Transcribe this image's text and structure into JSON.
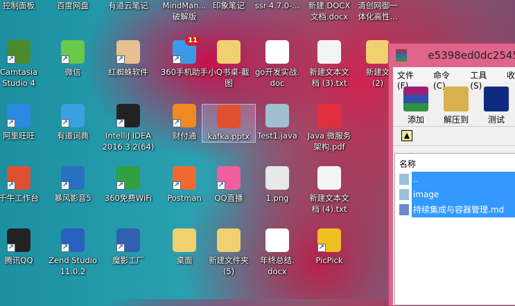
{
  "desktop": {
    "rows": [
      [
        {
          "label": "控制面板"
        },
        {
          "label": "百度网盘"
        },
        {
          "label": "有道云笔记"
        },
        {
          "label": "MindMan...\n破解版"
        },
        {
          "label": "印象笔记"
        },
        {
          "label": "ssr-4.7.0-..."
        },
        {
          "label": "新建 DOCX\n文档.docx"
        },
        {
          "label": "清创网御一\n体化高性..."
        }
      ],
      [
        {
          "label": "Camtasia\nStudio 4",
          "icon": "camtasia-icon",
          "color": "#4a8a2a",
          "shortcut": true
        },
        {
          "label": "微信",
          "icon": "wechat-icon",
          "color": "#6ac94a",
          "shortcut": true
        },
        {
          "label": "红蜘蛛软件",
          "icon": "red-spider-icon",
          "color": "#e8c090",
          "shortcut": true
        },
        {
          "label": "360手机助手",
          "icon": "360-phone-icon",
          "color": "#3a9ae8",
          "shortcut": true,
          "badge": "11"
        },
        {
          "label": "小Q书桌-截\n图",
          "icon": "folder-icon",
          "color": "#f0d070"
        },
        {
          "label": "go开发实战.\ndoc",
          "icon": "word-doc-icon",
          "color": "#ffffff"
        },
        {
          "label": "新建文本文\n档 (3).txt",
          "icon": "text-file-icon",
          "color": "#f4f4f4"
        },
        {
          "label": "新建文\n(2)",
          "icon": "folder-icon",
          "color": "#f0d070"
        }
      ],
      [
        {
          "label": "阿里旺旺",
          "icon": "aliwangwang-icon",
          "color": "#2a8ae0",
          "shortcut": true
        },
        {
          "label": "有道词典",
          "icon": "youdao-dict-icon",
          "color": "#3aa0e0",
          "shortcut": true
        },
        {
          "label": "IntelliJ IDEA\n2016.3.2(64)",
          "icon": "intellij-icon",
          "color": "#222222",
          "shortcut": true
        },
        {
          "label": "财付通",
          "icon": "tenpay-icon",
          "color": "#f08a20",
          "shortcut": true
        },
        {
          "label": "kafka.pptx",
          "icon": "pptx-icon",
          "color": "#e05030",
          "selected": true
        },
        {
          "label": "Test1.java",
          "icon": "java-file-icon",
          "color": "#a0c0d0"
        },
        {
          "label": "Java 微服务\n架构.pdf",
          "icon": "pdf-icon",
          "color": "#e03040"
        }
      ],
      [
        {
          "label": "千牛工作台",
          "icon": "qianniu-icon",
          "color": "#e05030",
          "shortcut": true
        },
        {
          "label": "暴风影音5",
          "icon": "baofeng-icon",
          "color": "#2a70c0",
          "shortcut": true
        },
        {
          "label": "360免费WiFi",
          "icon": "wifi-icon",
          "color": "#30a040",
          "shortcut": true
        },
        {
          "label": "Postman",
          "icon": "postman-icon",
          "color": "#f06a30",
          "shortcut": true
        },
        {
          "label": "QQ直播",
          "icon": "qq-live-icon",
          "color": "#f060a0",
          "shortcut": true
        },
        {
          "label": "1.png",
          "icon": "image-file-icon",
          "color": "#e8e8e8"
        },
        {
          "label": "新建文本文\n档 (4).txt",
          "icon": "text-file-icon",
          "color": "#f4f4f4"
        }
      ],
      [
        {
          "label": "腾讯QQ",
          "icon": "qq-icon",
          "color": "#222222",
          "shortcut": true
        },
        {
          "label": "Zend Studio\n11.0.2",
          "icon": "zend-icon",
          "color": "#2a60c0",
          "shortcut": true
        },
        {
          "label": "魔影工厂",
          "icon": "moying-icon",
          "color": "#3060b0",
          "shortcut": true
        },
        {
          "label": "桌面",
          "icon": "folder-icon",
          "color": "#f0d070"
        },
        {
          "label": "新建文件夹\n(5)",
          "icon": "folder-icon",
          "color": "#f0d070"
        },
        {
          "label": "年终总结.\ndocx",
          "icon": "word-doc-icon",
          "color": "#ffffff"
        },
        {
          "label": "PicPick",
          "icon": "picpick-icon",
          "color": "#f0c020",
          "shortcut": true
        }
      ]
    ]
  },
  "winrar": {
    "title": "e5398ed0dc2545",
    "menu": [
      "文件(F)",
      "命令(C)",
      "工具(S)",
      "收"
    ],
    "toolbar": [
      {
        "label": "添加",
        "icon": "add-archive-icon"
      },
      {
        "label": "解压到",
        "icon": "extract-icon"
      },
      {
        "label": "测试",
        "icon": "test-icon"
      }
    ],
    "column_header": "名称",
    "files": [
      {
        "name": ".."
      },
      {
        "name": "image"
      },
      {
        "name": "持续集成与容器管理.md"
      }
    ]
  }
}
